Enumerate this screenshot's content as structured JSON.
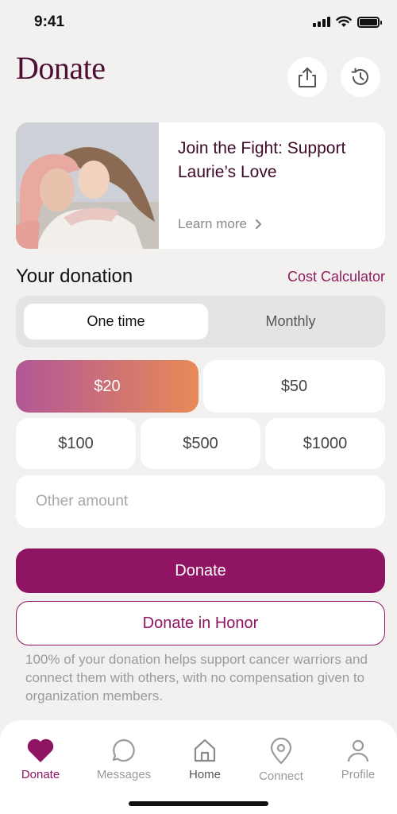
{
  "status_bar": {
    "time": "9:41"
  },
  "header": {
    "title": "Donate",
    "share_icon": "share-icon",
    "history_icon": "history-icon"
  },
  "campaign": {
    "title": "Join the Fight: Support Laurie’s Love",
    "learn_more": "Learn more"
  },
  "donation": {
    "section_title": "Your donation",
    "cost_calculator": "Cost Calculator",
    "frequency": {
      "options": [
        "One time",
        "Monthly"
      ],
      "selected": "One time"
    },
    "amounts": [
      "$20",
      "$50",
      "$100",
      "$500",
      "$1000"
    ],
    "selected_amount": "$20",
    "other_amount_placeholder": "Other amount",
    "donate_label": "Donate",
    "donate_honor_label": "Donate in Honor",
    "disclaimer": "100% of your donation helps support cancer warriors and connect them with others, with no compensation given to organization members."
  },
  "tab_bar": {
    "tabs": [
      {
        "label": "Donate",
        "icon": "heart-icon"
      },
      {
        "label": "Messages",
        "icon": "chat-icon"
      },
      {
        "label": "Home",
        "icon": "home-icon"
      },
      {
        "label": "Connect",
        "icon": "location-pin-icon"
      },
      {
        "label": "Profile",
        "icon": "person-icon"
      }
    ],
    "active": "Donate"
  },
  "colors": {
    "brand": "#8f1463",
    "title": "#4d0f33",
    "gradient_start": "#b15796",
    "gradient_end": "#e88a57",
    "background": "#f3f1ef"
  }
}
